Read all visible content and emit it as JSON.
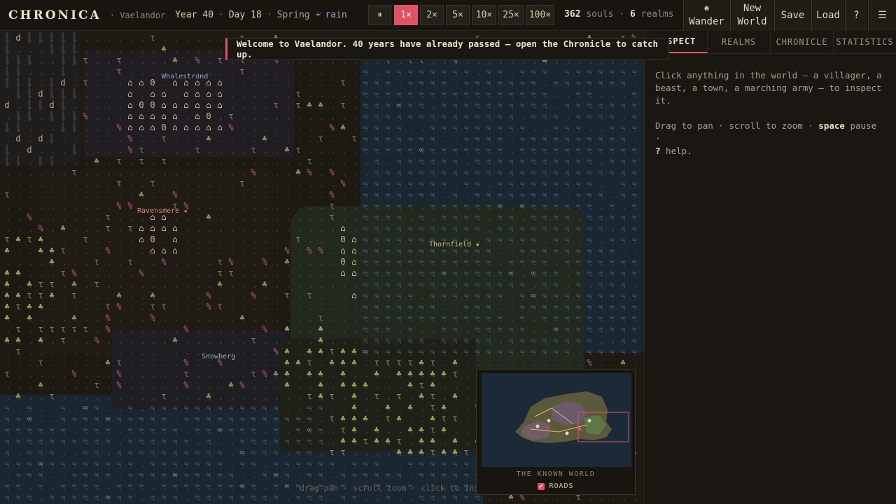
{
  "header": {
    "logo": "CHRONICA",
    "world": "· Vaelandor",
    "year": "Year 40",
    "day": "Day 18",
    "season": "Spring",
    "weather_icon": "rain-cloud-icon",
    "weather": "rain",
    "speeds": [
      "⏸",
      "1×",
      "2×",
      "5×",
      "10×",
      "25×",
      "100×"
    ],
    "active_speed": "1×",
    "souls_count": "362",
    "souls_label": "souls",
    "realms_count": "6",
    "realms_label": "realms",
    "wander_icon": "☻",
    "wander_label": "Wander",
    "new_world_line1": "New",
    "new_world_line2": "World",
    "save_label": "Save",
    "load_label": "Load",
    "help_label": "?",
    "menu_label": "☰"
  },
  "welcome": "Welcome to Vaelandor. 40 years have already passed — open the Chronicle to catch up.",
  "map": {
    "towns": [
      {
        "name": "Whalestrand",
        "color": "#8fa3c0"
      },
      {
        "name": "Ravensmere",
        "color": "#d98a7a"
      },
      {
        "name": "Thornfield",
        "color": "#c8b98a"
      },
      {
        "name": "Snowberg",
        "color": "#9da8c0"
      }
    ],
    "hint": "drag pan · scroll zoom · click to inspect"
  },
  "minimap": {
    "title": "THE KNOWN WORLD",
    "roads_label": "ROADS",
    "roads_checked": "✔"
  },
  "sidebar": {
    "tabs": [
      "INSPECT",
      "REALMS",
      "CHRONICLE",
      "STATISTICS"
    ],
    "active_tab": "INSPECT",
    "inspect_text": "Click anything in the world — a villager, a beast, a town, a marching army — to inspect it.",
    "controls_drag": "Drag to pan · scroll to zoom · ",
    "controls_space": "space",
    "controls_pause": " pause · ",
    "controls_help_key": "?",
    "controls_help": " help."
  },
  "colors": {
    "accent": "#e05266",
    "water": "#1c2a36",
    "grass": "#242a1e",
    "forest": "#96a05a",
    "town": "#e8d9a8"
  }
}
